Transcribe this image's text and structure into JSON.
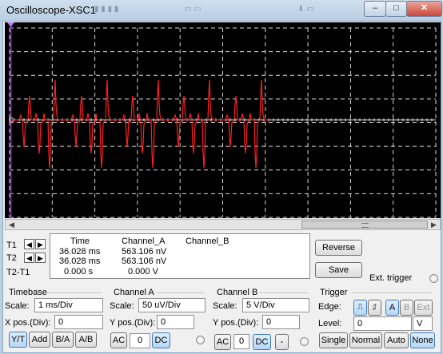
{
  "window": {
    "title": "Oscilloscope-XSC1",
    "minimize_glyph": "–",
    "maximize_glyph": "□",
    "close_glyph": "✕"
  },
  "cursors": {
    "t1_label": "T1",
    "t2_label": "T2",
    "t2t1_label": "T2-T1",
    "left_arrow": "◀",
    "right_arrow": "▶"
  },
  "readout": {
    "headers": [
      "Time",
      "Channel_A",
      "Channel_B"
    ],
    "rows": [
      {
        "time": "36.028 ms",
        "a": "563.106 nV",
        "b": ""
      },
      {
        "time": "36.028 ms",
        "a": "563.106 nV",
        "b": ""
      },
      {
        "time": "0.000 s",
        "a": "0.000 V",
        "b": ""
      }
    ]
  },
  "actions": {
    "reverse": "Reverse",
    "save": "Save",
    "ext_trigger": "Ext. trigger"
  },
  "timebase": {
    "title": "Timebase",
    "scale_label": "Scale:",
    "scale_value": "1 ms/Div",
    "xpos_label": "X pos.(Div):",
    "xpos_value": "0",
    "modes": [
      "Y/T",
      "Add",
      "B/A",
      "A/B"
    ],
    "selected_mode": "Y/T"
  },
  "channel_a": {
    "title": "Channel A",
    "scale_label": "Scale:",
    "scale_value": "50 uV/Div",
    "ypos_label": "Y pos.(Div):",
    "ypos_value": "0",
    "coupling": [
      "AC",
      "0",
      "DC"
    ],
    "selected": "DC"
  },
  "channel_b": {
    "title": "Channel B",
    "scale_label": "Scale:",
    "scale_value": "5  V/Div",
    "ypos_label": "Y pos.(Div):",
    "ypos_value": "0",
    "coupling": [
      "AC",
      "0",
      "DC",
      "-"
    ],
    "selected": "DC"
  },
  "trigger": {
    "title": "Trigger",
    "edge_label": "Edge:",
    "sources": [
      "A",
      "B",
      "Ext"
    ],
    "selected_source": "A",
    "level_label": "Level:",
    "level_value": "0",
    "level_unit": "V",
    "modes": [
      "Single",
      "Normal",
      "Auto",
      "None"
    ],
    "selected_mode": "None"
  },
  "colors": {
    "trace_a": "#ff2020",
    "grid": "#d8d8d8",
    "screen": "#000000",
    "cursor_t1": "#ff0000",
    "cursor_t2": "#3060ff"
  }
}
